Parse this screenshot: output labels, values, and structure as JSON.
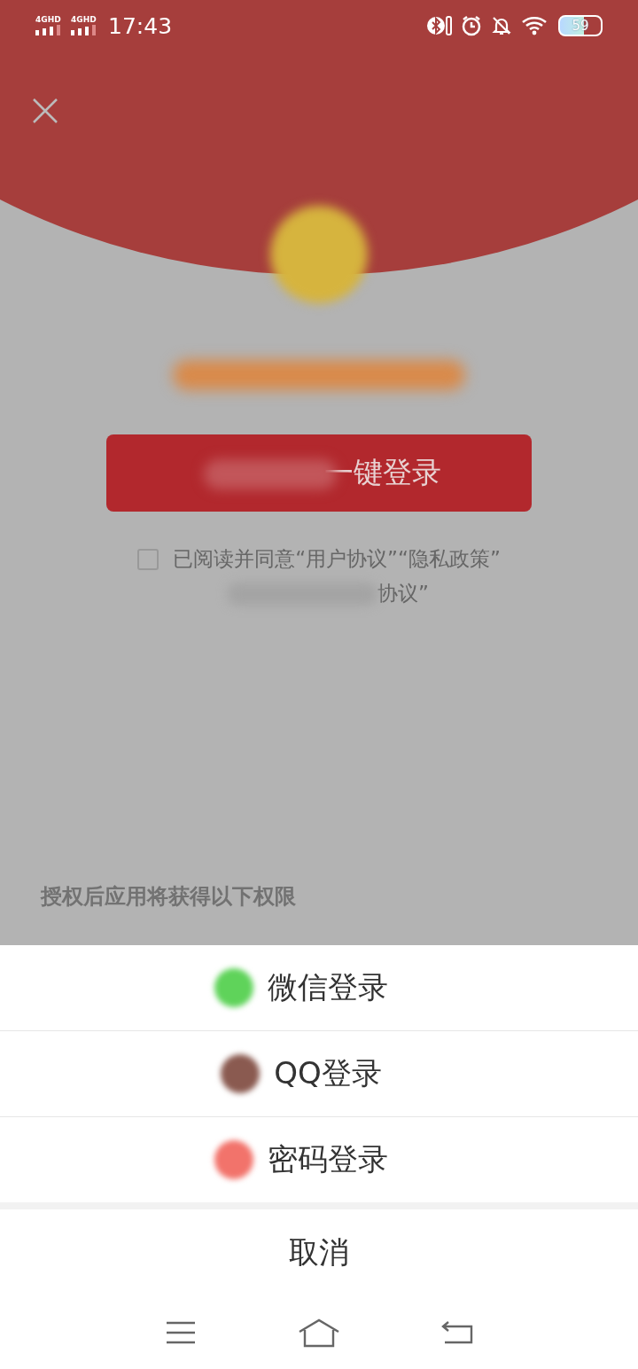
{
  "status_bar": {
    "networks": [
      "4GHD",
      "4GHD"
    ],
    "time": "17:43",
    "battery": "59"
  },
  "login": {
    "button_label": "一键登录",
    "agree_checked": false,
    "agreement_line1": "已阅读并同意“用户协议”“隐私政策”",
    "agreement_line2": "协议”"
  },
  "permissions": {
    "title": "授权后应用将获得以下权限"
  },
  "sheet": {
    "options": [
      {
        "label": "微信登录",
        "color": "#5fd35a"
      },
      {
        "label": "QQ登录",
        "color": "#8a5a50"
      },
      {
        "label": "密码登录",
        "color": "#f2736b"
      }
    ],
    "cancel": "取消"
  }
}
